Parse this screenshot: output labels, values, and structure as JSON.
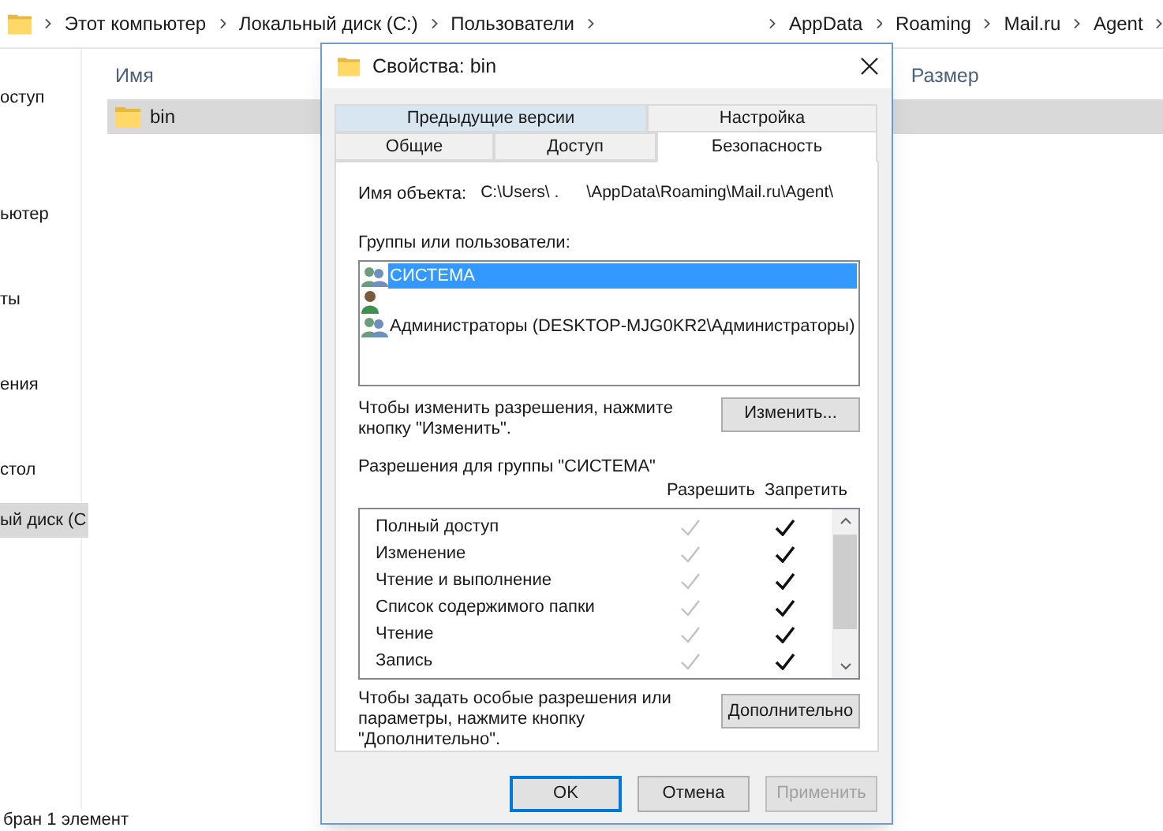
{
  "breadcrumb": [
    {
      "label": "Этот компьютер"
    },
    {
      "label": "Локальный диск (C:)"
    },
    {
      "label": "Пользователи"
    },
    {
      "kind": "blank"
    },
    {
      "label": "AppData"
    },
    {
      "label": "Roaming"
    },
    {
      "label": "Mail.ru"
    },
    {
      "label": "Agent"
    }
  ],
  "sidebar": {
    "items": [
      {
        "label": "оступ",
        "selected": false
      },
      {
        "label": "ьютер",
        "selected": false
      },
      {
        "label": "ты",
        "selected": false
      },
      {
        "label": "ения",
        "selected": false
      },
      {
        "label": "стол",
        "selected": false
      },
      {
        "label": "ый диск (С",
        "selected": true
      }
    ]
  },
  "file_list": {
    "columns": [
      "Имя",
      "Размер"
    ],
    "rows": [
      {
        "name": "bin",
        "selected": true
      }
    ]
  },
  "status_bar": "бран 1 элемент",
  "dialog": {
    "title": "Свойства: bin",
    "tabs_back": [
      {
        "label": "Предыдущие версии",
        "hover": true
      },
      {
        "label": "Настройка",
        "hover": false
      }
    ],
    "tabs_front": [
      {
        "label": "Общие",
        "selected": false
      },
      {
        "label": "Доступ",
        "selected": false
      },
      {
        "label": "Безопасность",
        "selected": true
      }
    ],
    "object_name_label": "Имя объекта:",
    "object_name": "C:\\Users\\ .      \\AppData\\Roaming\\Mail.ru\\Agent\\",
    "groups_label": "Группы или пользователи:",
    "groups": [
      {
        "kind": "group",
        "name": "СИСТЕМА",
        "selected": true
      },
      {
        "kind": "user",
        "selected": false
      },
      {
        "kind": "group",
        "name": "Администраторы (DESKTOP-MJG0KR2\\Администраторы)",
        "selected": false
      }
    ],
    "change_hint": "Чтобы изменить разрешения, нажмите кнопку \"Изменить\".",
    "change_button": "Изменить...",
    "permissions_label": "Разрешения для группы \"СИСТЕМА\"",
    "allow_header": "Разрешить",
    "deny_header": "Запретить",
    "permissions": [
      {
        "name": "Полный доступ",
        "allow": {
          "checked": true,
          "disabled": true
        },
        "deny": {
          "checked": true,
          "disabled": false
        }
      },
      {
        "name": "Изменение",
        "allow": {
          "checked": true,
          "disabled": true
        },
        "deny": {
          "checked": true,
          "disabled": false
        }
      },
      {
        "name": "Чтение и выполнение",
        "allow": {
          "checked": true,
          "disabled": true
        },
        "deny": {
          "checked": true,
          "disabled": false
        }
      },
      {
        "name": "Список содержимого папки",
        "allow": {
          "checked": true,
          "disabled": true
        },
        "deny": {
          "checked": true,
          "disabled": false
        }
      },
      {
        "name": "Чтение",
        "allow": {
          "checked": true,
          "disabled": true
        },
        "deny": {
          "checked": true,
          "disabled": false
        }
      },
      {
        "name": "Запись",
        "allow": {
          "checked": true,
          "disabled": true
        },
        "deny": {
          "checked": true,
          "disabled": false
        }
      }
    ],
    "advanced_hint": "Чтобы задать особые разрешения или параметры, нажмите кнопку \"Дополнительно\".",
    "advanced_button": "Дополнительно",
    "buttons": [
      {
        "label": "OK",
        "default": true,
        "disabled": false
      },
      {
        "label": "Отмена",
        "default": false,
        "disabled": false
      },
      {
        "label": "Применить",
        "default": false,
        "disabled": true
      }
    ]
  }
}
